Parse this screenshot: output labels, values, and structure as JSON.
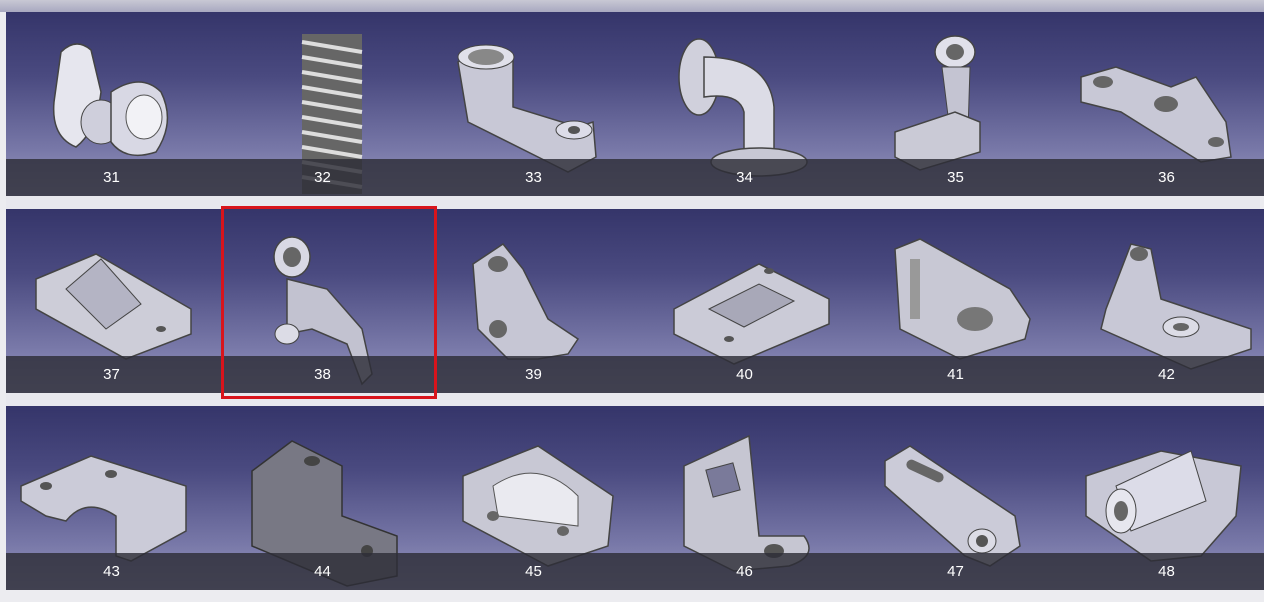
{
  "gallery": {
    "selected_index": 7,
    "highlight_color": "#d8141c",
    "tiles": [
      {
        "label": "31",
        "icon": "cam-part-icon"
      },
      {
        "label": "32",
        "icon": "threaded-rod-icon"
      },
      {
        "label": "33",
        "icon": "lever-arm-icon"
      },
      {
        "label": "34",
        "icon": "pipe-elbow-icon"
      },
      {
        "label": "35",
        "icon": "bracket-stand-icon"
      },
      {
        "label": "36",
        "icon": "link-plate-icon"
      },
      {
        "label": "37",
        "icon": "v-block-icon"
      },
      {
        "label": "38",
        "icon": "rocker-arm-icon"
      },
      {
        "label": "39",
        "icon": "fork-bracket-icon"
      },
      {
        "label": "40",
        "icon": "pocket-plate-icon"
      },
      {
        "label": "41",
        "icon": "slotted-block-icon"
      },
      {
        "label": "42",
        "icon": "angle-bracket-icon"
      },
      {
        "label": "43",
        "icon": "half-clamp-icon"
      },
      {
        "label": "44",
        "icon": "step-block-icon"
      },
      {
        "label": "45",
        "icon": "saddle-block-icon"
      },
      {
        "label": "46",
        "icon": "sheet-metal-bracket-icon"
      },
      {
        "label": "47",
        "icon": "slotted-lever-icon"
      },
      {
        "label": "48",
        "icon": "pillow-block-icon"
      }
    ]
  }
}
